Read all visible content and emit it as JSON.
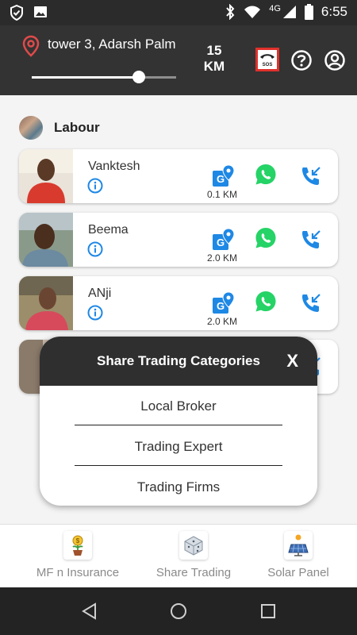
{
  "status_bar": {
    "network": "4G",
    "time": "6:55"
  },
  "header": {
    "location": "tower 3, Adarsh Palm",
    "radius_fraction": 0.74,
    "distance_value": "15",
    "distance_unit": "KM",
    "sos_label": "SOS"
  },
  "section": {
    "title": "Labour"
  },
  "workers": [
    {
      "name": "Vanktesh",
      "distance": "0.1 KM"
    },
    {
      "name": "Beema",
      "distance": "2.0 KM"
    },
    {
      "name": "ANji",
      "distance": "2.0 KM"
    }
  ],
  "modal": {
    "title": "Share Trading Categories",
    "close_label": "X",
    "items": [
      "Local Broker",
      "Trading Expert",
      "Trading Firms"
    ]
  },
  "bottom_nav": {
    "items": [
      {
        "label": "MF n Insurance",
        "icon": "money-plant-icon"
      },
      {
        "label": "Share Trading",
        "icon": "dice-icon"
      },
      {
        "label": "Solar Panel",
        "icon": "solar-panel-icon"
      }
    ]
  },
  "colors": {
    "header_bg": "#333333",
    "accent_blue": "#1e88e5",
    "whatsapp_green": "#25d366",
    "sos_red": "#e0302b"
  }
}
